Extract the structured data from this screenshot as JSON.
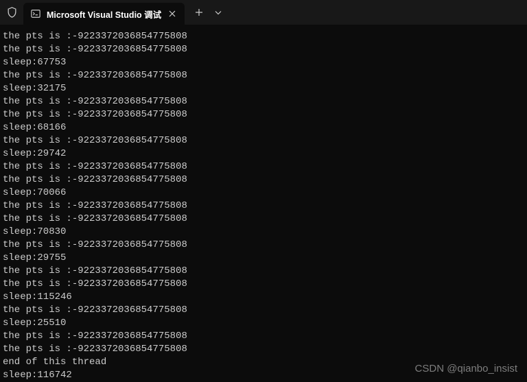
{
  "titlebar": {
    "tab_title": "Microsoft Visual Studio 调试"
  },
  "console": {
    "lines": [
      "the pts is :-9223372036854775808",
      "the pts is :-9223372036854775808",
      "sleep:67753",
      "the pts is :-9223372036854775808",
      "sleep:32175",
      "the pts is :-9223372036854775808",
      "the pts is :-9223372036854775808",
      "sleep:68166",
      "the pts is :-9223372036854775808",
      "sleep:29742",
      "the pts is :-9223372036854775808",
      "the pts is :-9223372036854775808",
      "sleep:70066",
      "the pts is :-9223372036854775808",
      "the pts is :-9223372036854775808",
      "sleep:70830",
      "the pts is :-9223372036854775808",
      "sleep:29755",
      "the pts is :-9223372036854775808",
      "the pts is :-9223372036854775808",
      "sleep:115246",
      "the pts is :-9223372036854775808",
      "sleep:25510",
      "the pts is :-9223372036854775808",
      "the pts is :-9223372036854775808",
      "end of this thread",
      "sleep:116742"
    ]
  },
  "watermark": {
    "text": "CSDN @qianbo_insist"
  }
}
